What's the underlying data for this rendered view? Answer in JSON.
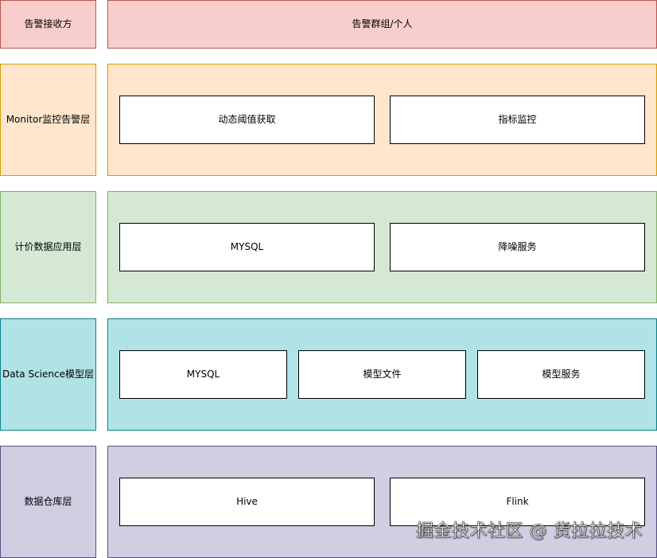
{
  "colors": {
    "alert_fill": "#f8cecc",
    "alert_stroke": "#b85450",
    "monitor_fill": "#ffe6cc",
    "monitor_stroke": "#d79b00",
    "pricing_fill": "#d5e8d4",
    "pricing_stroke": "#82b366",
    "ds_fill": "#b0e3e6",
    "ds_stroke": "#0e8088",
    "dw_fill": "#d0cee2",
    "dw_stroke": "#56517e",
    "inner_fill": "#ffffff",
    "inner_stroke": "#000000"
  },
  "layers": {
    "alert": {
      "label": "告警接收方",
      "panel_text": "告警群组/个人"
    },
    "monitor": {
      "label": "Monitor监控告警层",
      "boxes": [
        "动态阈值获取",
        "指标监控"
      ]
    },
    "pricing": {
      "label": "计价数据应用层",
      "boxes": [
        "MYSQL",
        "降噪服务"
      ]
    },
    "data_science": {
      "label": "Data Science模型层",
      "boxes": [
        "MYSQL",
        "模型文件",
        "模型服务"
      ]
    },
    "data_warehouse": {
      "label": "数据仓库层",
      "boxes": [
        "Hive",
        "Flink"
      ]
    }
  },
  "watermark": "掘金技术社区 @ 货拉拉技术"
}
